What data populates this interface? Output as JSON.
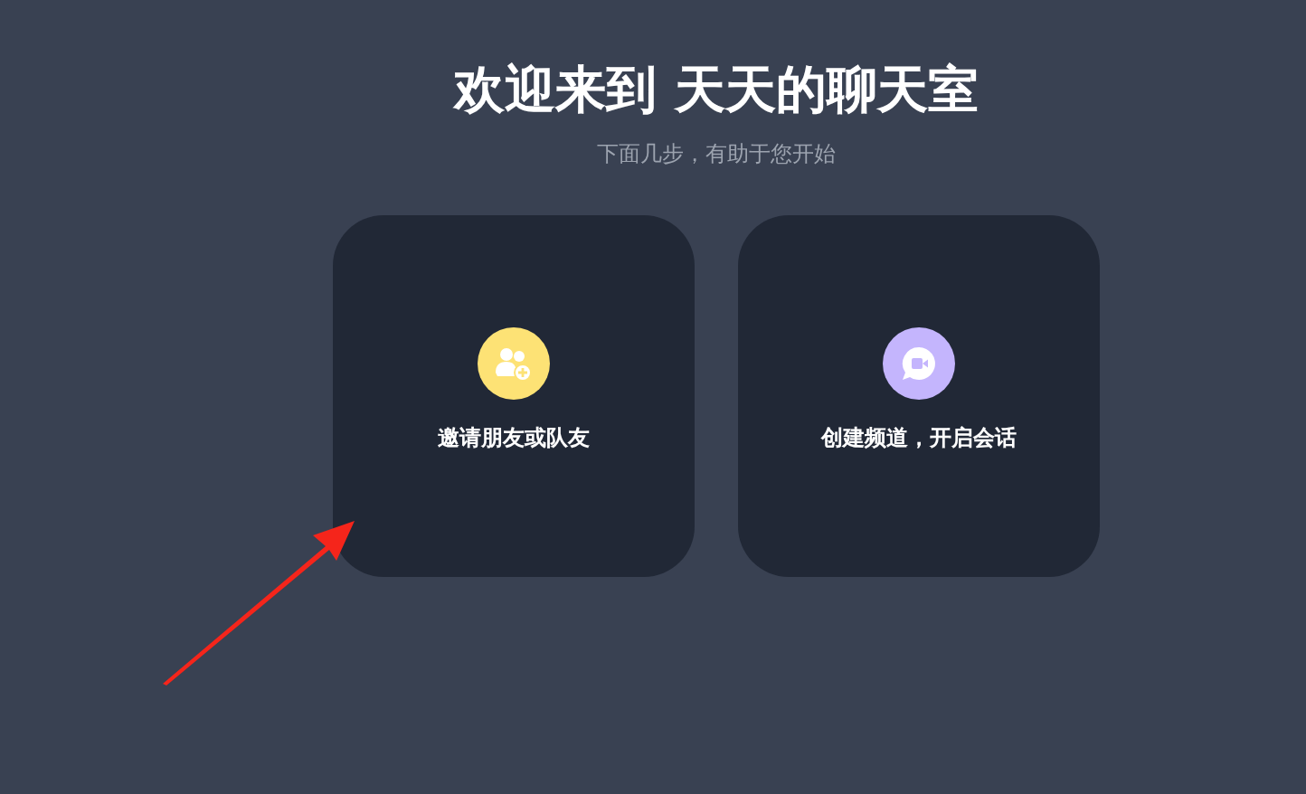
{
  "title": "欢迎来到 天天的聊天室",
  "subtitle": "下面几步，有助于您开始",
  "cards": [
    {
      "kind": "invite",
      "label": "邀请朋友或队友",
      "color": "#fde275"
    },
    {
      "kind": "channel",
      "label": "创建频道，开启会话",
      "color": "#c4b5fd"
    }
  ]
}
